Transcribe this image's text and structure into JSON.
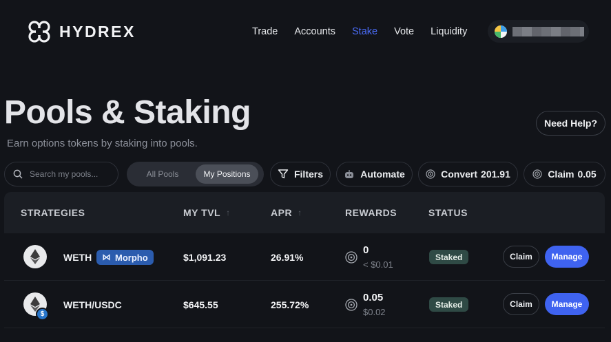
{
  "brand": {
    "name": "HYDREX"
  },
  "nav": {
    "items": [
      "Trade",
      "Accounts",
      "Stake",
      "Vote",
      "Liquidity"
    ],
    "active": "Stake"
  },
  "hero": {
    "title": "Pools & Staking",
    "subtitle": "Earn options tokens by staking into pools.",
    "help_label": "Need Help?"
  },
  "toolbar": {
    "search_placeholder": "Search my pools...",
    "tab_all": "All Pools",
    "tab_mine": "My Positions",
    "filters_label": "Filters",
    "automate_label": "Automate",
    "convert_label": "Convert",
    "convert_value": "201.91",
    "claim_label": "Claim",
    "claim_value": "0.05"
  },
  "table": {
    "headers": {
      "strategies": "STRATEGIES",
      "tvl": "MY TVL",
      "apr": "APR",
      "rewards": "REWARDS",
      "status": "STATUS"
    },
    "rows": [
      {
        "pool": "WETH",
        "tag": "Morpho",
        "tvl": "$1,091.23",
        "apr": "26.91%",
        "reward_amount": "0",
        "reward_usd": "< $0.01",
        "status": "Staked",
        "claim": "Claim",
        "manage": "Manage"
      },
      {
        "pool": "WETH/USDC",
        "tvl": "$645.55",
        "apr": "255.72%",
        "reward_amount": "0.05",
        "reward_usd": "$0.02",
        "status": "Staked",
        "claim": "Claim",
        "manage": "Manage"
      }
    ]
  },
  "colors": {
    "accent": "#3f63f0",
    "background": "#121419",
    "status_staked": "#2f4a45",
    "morpho_tag": "#2b5cae"
  },
  "icons": [
    "hydrex-logo-icon",
    "wallet-avatar-icon",
    "search-icon",
    "filter-icon",
    "robot-icon",
    "target-icon",
    "eth-icon",
    "usdc-icon",
    "morpho-icon",
    "sort-arrow-icon"
  ]
}
